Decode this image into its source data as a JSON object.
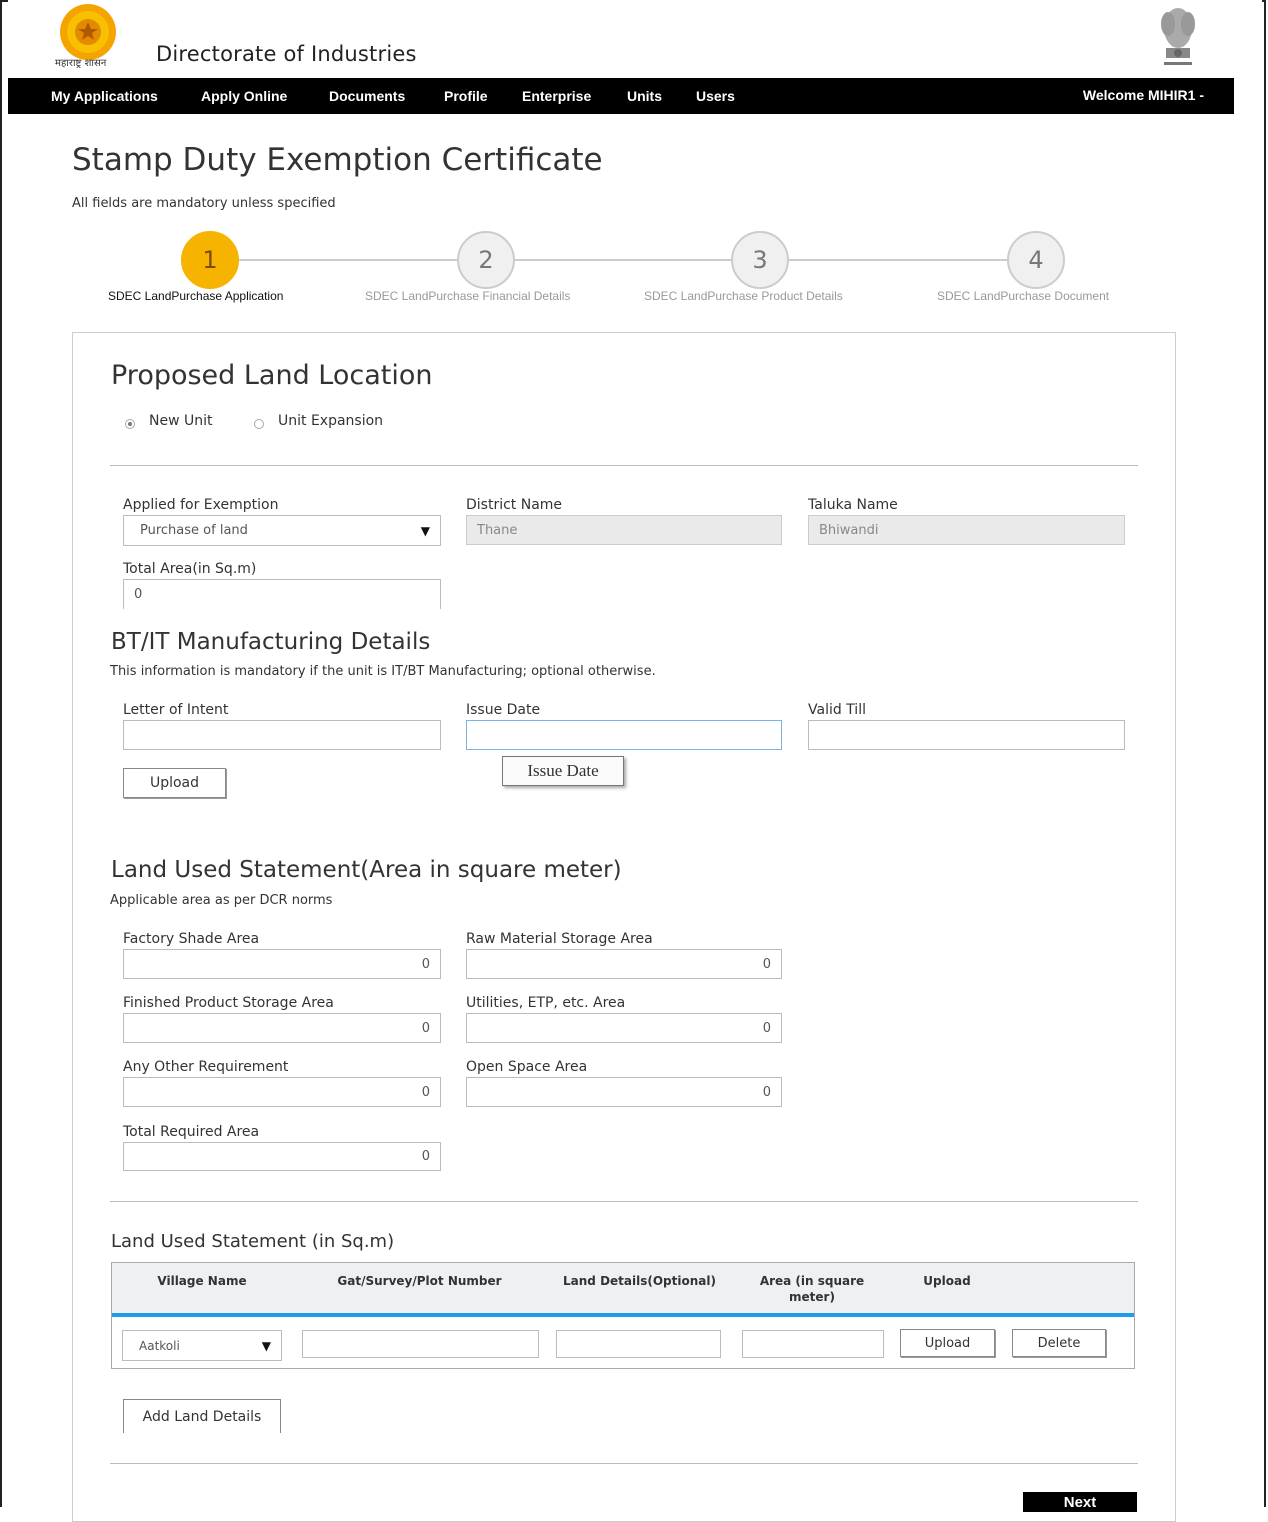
{
  "header": {
    "state_text": "महाराष्ट्र शासन",
    "site_title": "Directorate of Industries"
  },
  "nav": {
    "items": [
      "My Applications",
      "Apply Online",
      "Documents",
      "Profile",
      "Enterprise",
      "Units",
      "Users"
    ],
    "welcome": "Welcome MIHIR1 -"
  },
  "page": {
    "title": "Stamp Duty Exemption Certificate",
    "mandatory_note": "All fields are mandatory unless specified"
  },
  "steps": [
    {
      "num": "1",
      "label": "SDEC LandPurchase Application",
      "active": true
    },
    {
      "num": "2",
      "label": "SDEC LandPurchase Financial Details",
      "active": false
    },
    {
      "num": "3",
      "label": "SDEC LandPurchase Product Details",
      "active": false
    },
    {
      "num": "4",
      "label": "SDEC LandPurchase Document",
      "active": false
    }
  ],
  "location": {
    "title": "Proposed Land Location",
    "radio_new": "New Unit",
    "radio_expansion": "Unit Expansion",
    "applied_label": "Applied for Exemption",
    "applied_value": "Purchase of land",
    "district_label": "District Name",
    "district_value": "Thane",
    "taluka_label": "Taluka Name",
    "taluka_value": "Bhiwandi",
    "total_area_label": "Total Area(in Sq.m)",
    "total_area_value": "0"
  },
  "btit": {
    "title": "BT/IT Manufacturing Details",
    "note": "This information is mandatory if the unit is IT/BT Manufacturing; optional otherwise.",
    "loi_label": "Letter of Intent",
    "issue_label": "Issue Date",
    "valid_label": "Valid Till",
    "upload_label": "Upload",
    "tooltip": "Issue Date"
  },
  "land_used": {
    "title": "Land Used Statement(Area in square meter)",
    "note": "Applicable area as per DCR norms",
    "factory_label": "Factory Shade Area",
    "factory_value": "0",
    "raw_label": "Raw Material Storage Area",
    "raw_value": "0",
    "finished_label": "Finished Product Storage Area",
    "finished_value": "0",
    "utilities_label": "Utilities, ETP, etc. Area",
    "utilities_value": "0",
    "other_label": "Any Other Requirement",
    "other_value": "0",
    "open_label": "Open Space Area",
    "open_value": "0",
    "total_label": "Total Required Area",
    "total_value": "0"
  },
  "land_table": {
    "title": "Land Used Statement (in Sq.m)",
    "headers": [
      "Village Name",
      "Gat/Survey/Plot Number",
      "Land Details(Optional)",
      "Area (in square meter)",
      "Upload"
    ],
    "village_value": "Aatkoli",
    "upload_label": "Upload",
    "delete_label": "Delete",
    "add_label": "Add Land Details"
  },
  "footer": {
    "next_label": "Next"
  }
}
